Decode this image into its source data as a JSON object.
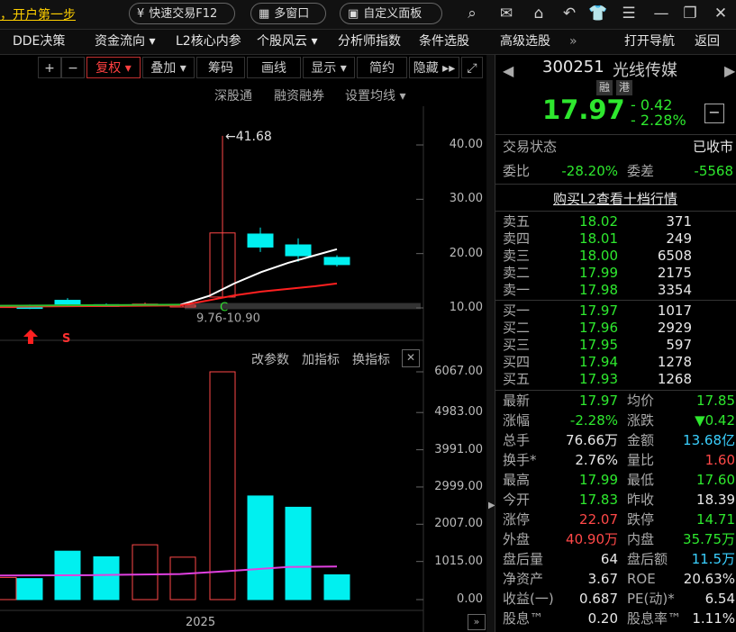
{
  "topbar": {
    "tip": "，开户第一步",
    "quick_trade": "快速交易F12",
    "multi_window": "多窗口",
    "custom_panel": "自定义面板"
  },
  "menu": [
    "DDE决策",
    "资金流向 ▾",
    "L2核心内参",
    "个股风云 ▾",
    "分析师指数",
    "条件选股",
    "高级选股",
    "»",
    "打开导航",
    "返回"
  ],
  "chart_toolbar": {
    "plus": "+",
    "minus": "−",
    "fuquan": "复权 ▾",
    "overlay": "叠加 ▾",
    "chips": "筹码",
    "draw": "画线",
    "display": "显示 ▾",
    "simple": "简约",
    "hide": "隐藏 ▸▸"
  },
  "chart_sub": {
    "sgt": "深股通",
    "margin": "融资融券",
    "ma_setting": "设置均线 ▾"
  },
  "price_chart": {
    "axis": [
      "40.00",
      "30.00",
      "20.00",
      "10.00"
    ],
    "high_label": "41.68",
    "range_label": "9.76-10.90",
    "c_marker": "C",
    "s_marker": "S"
  },
  "volume_chart": {
    "buttons": {
      "params": "改参数",
      "add": "加指标",
      "switch": "换指标"
    },
    "axis": [
      "6067.00",
      "4983.00",
      "3991.00",
      "2999.00",
      "2007.00",
      "1015.00",
      "0.00"
    ],
    "year": "2025"
  },
  "chart_data": {
    "type": "candlestick",
    "ylim_price": [
      9,
      44
    ],
    "ylim_volume": [
      0,
      6500
    ],
    "candles": [
      {
        "o": 10.3,
        "h": 10.5,
        "l": 10.0,
        "c": 10.4,
        "v": 590
      },
      {
        "o": 10.4,
        "h": 10.6,
        "l": 9.8,
        "c": 9.9,
        "v": 560
      },
      {
        "o": 11.4,
        "h": 11.8,
        "l": 10.6,
        "c": 10.7,
        "v": 1290
      },
      {
        "o": 10.6,
        "h": 10.8,
        "l": 10.3,
        "c": 10.4,
        "v": 1140
      },
      {
        "o": 10.5,
        "h": 11.0,
        "l": 10.3,
        "c": 10.7,
        "v": 1460
      },
      {
        "o": 10.4,
        "h": 10.9,
        "l": 10.2,
        "c": 10.5,
        "v": 1130
      },
      {
        "o": 12.0,
        "h": 41.68,
        "l": 11.9,
        "c": 23.8,
        "v": 6067
      },
      {
        "o": 23.6,
        "h": 24.8,
        "l": 20.3,
        "c": 21.2,
        "v": 2760
      },
      {
        "o": 21.6,
        "h": 22.8,
        "l": 18.5,
        "c": 19.6,
        "v": 2460
      },
      {
        "o": 19.3,
        "h": 19.7,
        "l": 17.6,
        "c": 17.97,
        "v": 660
      }
    ]
  },
  "stock": {
    "code": "300251",
    "name": "光线传媒",
    "tag_margin": "融",
    "tag_hk": "港",
    "price": "17.97",
    "change": "- 0.42",
    "change_pct": "- 2.28%",
    "trade_status_label": "交易状态",
    "trade_status": "已收市",
    "weibi_label": "委比",
    "weibi": "-28.20%",
    "weicha_label": "委差",
    "weicha": "-5568",
    "l2_link": "购买L2查看十档行情"
  },
  "order_book": {
    "asks": [
      {
        "label": "卖五",
        "price": "18.02",
        "vol": "371"
      },
      {
        "label": "卖四",
        "price": "18.01",
        "vol": "249"
      },
      {
        "label": "卖三",
        "price": "18.00",
        "vol": "6508"
      },
      {
        "label": "卖二",
        "price": "17.99",
        "vol": "2175"
      },
      {
        "label": "卖一",
        "price": "17.98",
        "vol": "3354"
      }
    ],
    "bids": [
      {
        "label": "买一",
        "price": "17.97",
        "vol": "1017"
      },
      {
        "label": "买二",
        "price": "17.96",
        "vol": "2929"
      },
      {
        "label": "买三",
        "price": "17.95",
        "vol": "597"
      },
      {
        "label": "买四",
        "price": "17.94",
        "vol": "1278"
      },
      {
        "label": "买五",
        "price": "17.93",
        "vol": "1268"
      }
    ]
  },
  "stats": [
    {
      "l1": "最新",
      "v1": "17.97",
      "c1": "green",
      "l2": "均价",
      "v2": "17.85",
      "c2": "green"
    },
    {
      "l1": "涨幅",
      "v1": "-2.28%",
      "c1": "green",
      "l2": "涨跌",
      "v2": "▼0.42",
      "c2": "green"
    },
    {
      "l1": "总手",
      "v1": "76.66万",
      "c1": "white",
      "l2": "金额",
      "v2": "13.68亿",
      "c2": "cyan"
    },
    {
      "l1": "换手*",
      "v1": "2.76%",
      "c1": "white",
      "l2": "量比",
      "v2": "1.60",
      "c2": "red"
    },
    {
      "l1": "最高",
      "v1": "17.99",
      "c1": "green",
      "l2": "最低",
      "v2": "17.60",
      "c2": "green"
    },
    {
      "l1": "今开",
      "v1": "17.83",
      "c1": "green",
      "l2": "昨收",
      "v2": "18.39",
      "c2": "white"
    },
    {
      "l1": "涨停",
      "v1": "22.07",
      "c1": "red",
      "l2": "跌停",
      "v2": "14.71",
      "c2": "green"
    },
    {
      "l1": "外盘",
      "v1": "40.90万",
      "c1": "red",
      "l2": "内盘",
      "v2": "35.75万",
      "c2": "green"
    },
    {
      "l1": "盘后量",
      "v1": "64",
      "c1": "white",
      "l2": "盘后额",
      "v2": "11.5万",
      "c2": "cyan"
    },
    {
      "l1": "净资产",
      "v1": "3.67",
      "c1": "white",
      "l2": "ROE",
      "v2": "20.63%",
      "c2": "white"
    },
    {
      "l1": "收益(一)",
      "v1": "0.687",
      "c1": "white",
      "l2": "PE(动)*",
      "v2": "6.54",
      "c2": "white"
    },
    {
      "l1": "股息™",
      "v1": "0.20",
      "c1": "white",
      "l2": "股息率™",
      "v2": "1.11%",
      "c2": "white"
    }
  ],
  "colors": {
    "up": "#ff4848",
    "down": "#00f0f0",
    "ma5": "#ffffff",
    "ma10": "#ff2020",
    "vol_ma": "#e040e0"
  }
}
